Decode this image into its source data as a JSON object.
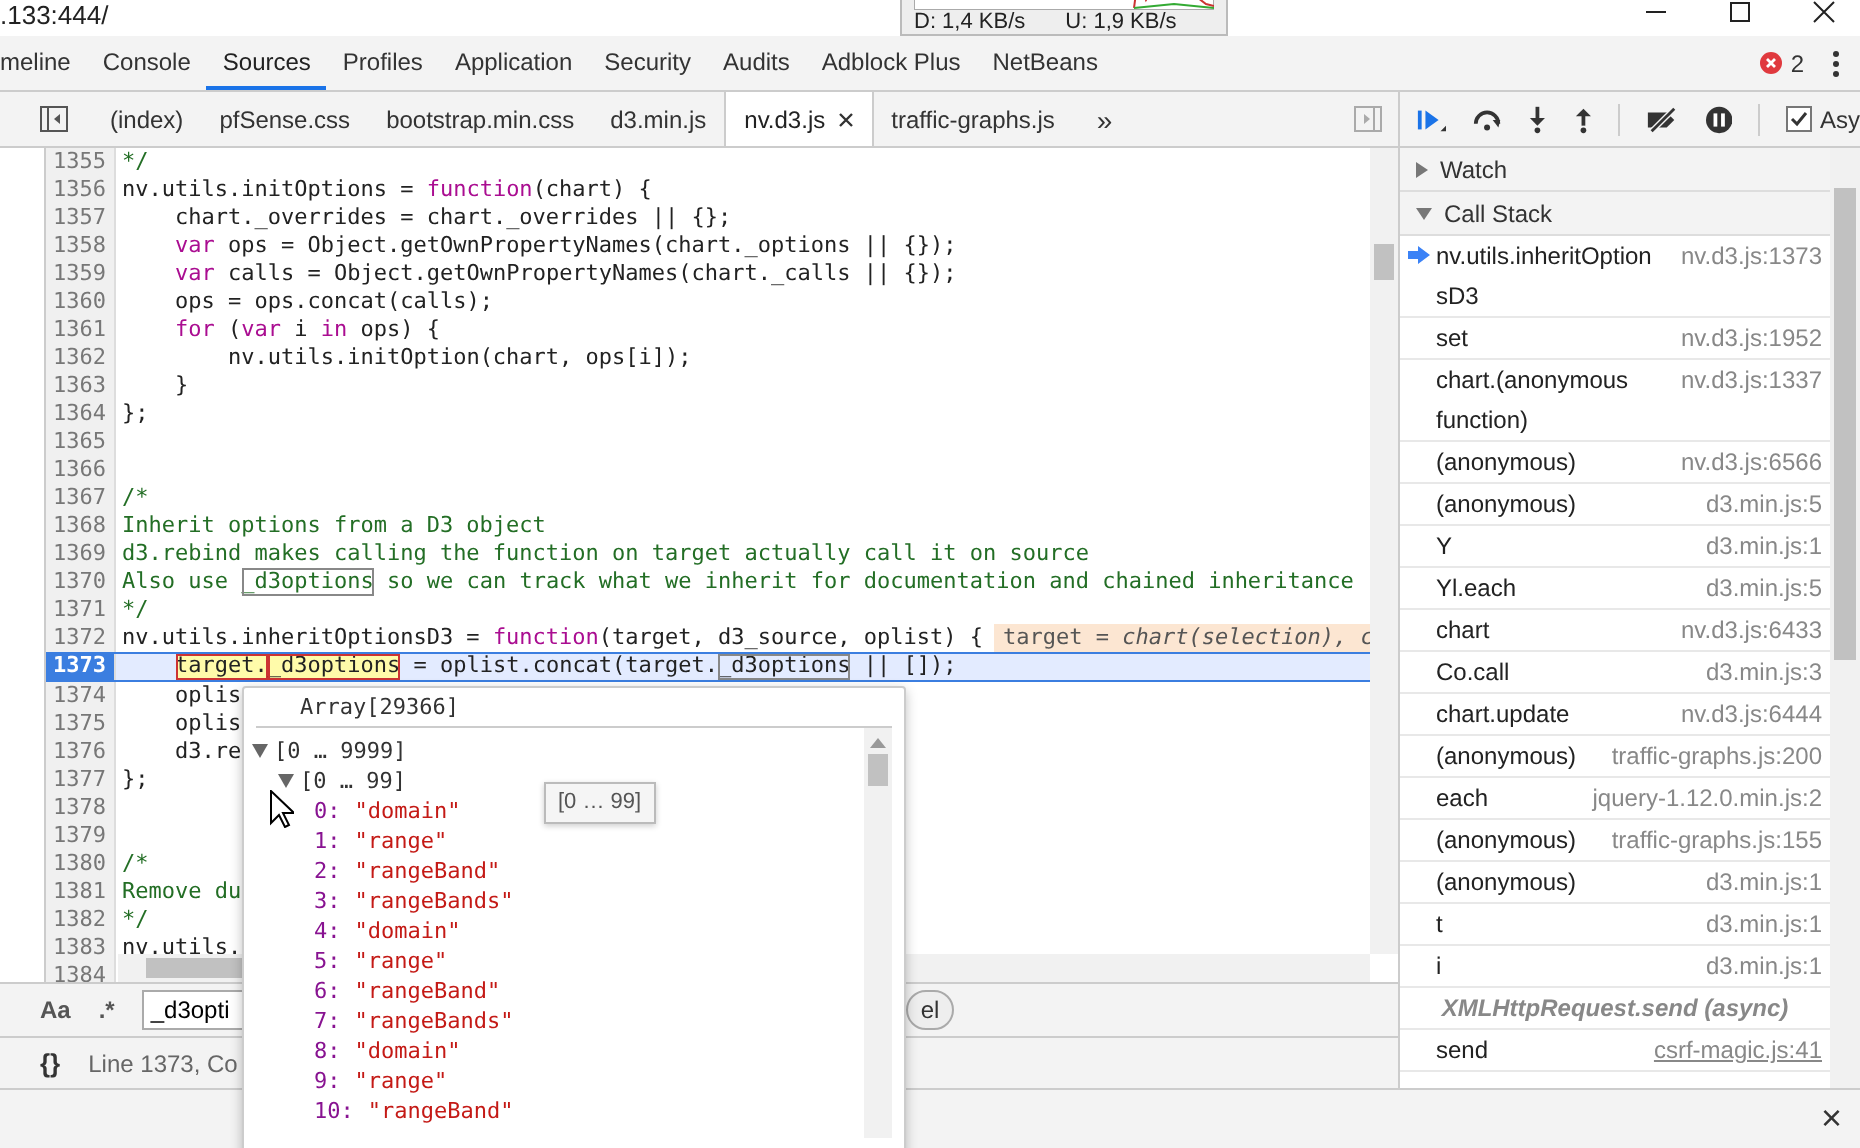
{
  "address": ".133:444/",
  "network_widget": {
    "download": "D: 1,4 KB/s",
    "upload": "U: 1,9 KB/s"
  },
  "panel_tabs": [
    {
      "label": "meline",
      "selected": false
    },
    {
      "label": "Console",
      "selected": false
    },
    {
      "label": "Sources",
      "selected": true
    },
    {
      "label": "Profiles",
      "selected": false
    },
    {
      "label": "Application",
      "selected": false
    },
    {
      "label": "Security",
      "selected": false
    },
    {
      "label": "Audits",
      "selected": false
    },
    {
      "label": "Adblock Plus",
      "selected": false
    },
    {
      "label": "NetBeans",
      "selected": false
    }
  ],
  "error_count": "2",
  "file_tabs": [
    {
      "label": "(index)",
      "selected": false
    },
    {
      "label": "pfSense.css",
      "selected": false
    },
    {
      "label": "bootstrap.min.css",
      "selected": false
    },
    {
      "label": "d3.min.js",
      "selected": false
    },
    {
      "label": "nv.d3.js",
      "selected": true
    },
    {
      "label": "traffic-graphs.js",
      "selected": false
    }
  ],
  "more_tabs": "»",
  "async_checkbox": {
    "label": "Asy",
    "checked": true
  },
  "code": [
    {
      "number": "1355",
      "current": false,
      "tokens": [
        {
          "kind": "comment",
          "text": "*/"
        }
      ]
    },
    {
      "number": "1356",
      "current": false,
      "tokens": [
        {
          "kind": "plain",
          "text": "nv.utils.initOptions = "
        },
        {
          "kind": "keyword",
          "text": "function"
        },
        {
          "kind": "plain",
          "text": "(chart) {"
        }
      ]
    },
    {
      "number": "1357",
      "current": false,
      "tokens": [
        {
          "kind": "plain",
          "text": "    chart._overrides = chart._overrides || {};"
        }
      ]
    },
    {
      "number": "1358",
      "current": false,
      "tokens": [
        {
          "kind": "keyword",
          "text": "    var"
        },
        {
          "kind": "plain",
          "text": " ops = Object.getOwnPropertyNames(chart._options || {});"
        }
      ]
    },
    {
      "number": "1359",
      "current": false,
      "tokens": [
        {
          "kind": "keyword",
          "text": "    var"
        },
        {
          "kind": "plain",
          "text": " calls = Object.getOwnPropertyNames(chart._calls || {});"
        }
      ]
    },
    {
      "number": "1360",
      "current": false,
      "tokens": [
        {
          "kind": "plain",
          "text": "    ops = ops.concat(calls);"
        }
      ]
    },
    {
      "number": "1361",
      "current": false,
      "tokens": [
        {
          "kind": "keyword",
          "text": "    for"
        },
        {
          "kind": "plain",
          "text": " ("
        },
        {
          "kind": "keyword",
          "text": "var"
        },
        {
          "kind": "plain",
          "text": " i "
        },
        {
          "kind": "keyword",
          "text": "in"
        },
        {
          "kind": "plain",
          "text": " ops) {"
        }
      ]
    },
    {
      "number": "1362",
      "current": false,
      "tokens": [
        {
          "kind": "plain",
          "text": "        nv.utils.initOption(chart, ops[i]);"
        }
      ]
    },
    {
      "number": "1363",
      "current": false,
      "tokens": [
        {
          "kind": "plain",
          "text": "    }"
        }
      ]
    },
    {
      "number": "1364",
      "current": false,
      "tokens": [
        {
          "kind": "plain",
          "text": "};"
        }
      ]
    },
    {
      "number": "1365",
      "current": false
    },
    {
      "number": "1366",
      "current": false
    },
    {
      "number": "1367",
      "current": false,
      "tokens": [
        {
          "kind": "comment",
          "text": "/*"
        }
      ]
    },
    {
      "number": "1368",
      "current": false,
      "tokens": [
        {
          "kind": "comment",
          "text": "Inherit options from a D3 object"
        }
      ]
    },
    {
      "number": "1369",
      "current": false,
      "tokens": [
        {
          "kind": "comment",
          "text": "d3.rebind makes calling the function on target actually call it on source"
        }
      ]
    },
    {
      "number": "1370",
      "current": false,
      "tokens": [
        {
          "kind": "comment",
          "text": "Also use "
        },
        {
          "kind": "comment-match",
          "text": "_d3options"
        },
        {
          "kind": "comment",
          "text": " so we can track what we inherit for documentation and chained inheritance"
        }
      ]
    },
    {
      "number": "1371",
      "current": false,
      "tokens": [
        {
          "kind": "comment",
          "text": "*/"
        }
      ]
    },
    {
      "number": "1372",
      "current": false,
      "tokens": [
        {
          "kind": "plain",
          "text": "nv.utils.inheritOptionsD3 = "
        },
        {
          "kind": "keyword",
          "text": "function"
        },
        {
          "kind": "plain",
          "text": "(target, d3_source, oplist) {"
        }
      ],
      "inline_value": "target = *chart(selection), c*"
    },
    {
      "number": "1373",
      "current": true,
      "tokens": [
        {
          "kind": "hover",
          "text": "    target."
        },
        {
          "kind": "hover-match",
          "text": "_d3options"
        },
        {
          "kind": "plain",
          "text": " = oplist.concat(target."
        },
        {
          "kind": "match",
          "text": "_d3options"
        },
        {
          "kind": "plain",
          "text": " || []);"
        }
      ]
    },
    {
      "number": "1374",
      "current": false,
      "tokens": [
        {
          "kind": "plain",
          "text": "    oplis"
        }
      ]
    },
    {
      "number": "1375",
      "current": false,
      "tokens": [
        {
          "kind": "plain",
          "text": "    oplis"
        }
      ]
    },
    {
      "number": "1376",
      "current": false,
      "tokens": [
        {
          "kind": "plain",
          "text": "    d3.re"
        }
      ]
    },
    {
      "number": "1377",
      "current": false,
      "tokens": [
        {
          "kind": "plain",
          "text": "};"
        }
      ]
    },
    {
      "number": "1378",
      "current": false
    },
    {
      "number": "1379",
      "current": false
    },
    {
      "number": "1380",
      "current": false,
      "tokens": [
        {
          "kind": "comment",
          "text": "/*"
        }
      ]
    },
    {
      "number": "1381",
      "current": false,
      "tokens": [
        {
          "kind": "comment",
          "text": "Remove du"
        }
      ]
    },
    {
      "number": "1382",
      "current": false,
      "tokens": [
        {
          "kind": "comment",
          "text": "*/"
        }
      ]
    },
    {
      "number": "1383",
      "current": false,
      "tokens": [
        {
          "kind": "plain",
          "text": "nv.utils."
        }
      ]
    },
    {
      "number": "1384",
      "current": false
    }
  ],
  "popup": {
    "title": "Array[29366]",
    "tree": [
      {
        "label": "[0 … 9999]",
        "expanded": true,
        "children": [
          {
            "label": "[0 … 99]",
            "expanded": true,
            "tooltip": "[0 … 99]",
            "children": [
              {
                "index": "0:",
                "value": "\"domain\""
              },
              {
                "index": "1:",
                "value": "\"range\""
              },
              {
                "index": "2:",
                "value": "\"rangeBand\""
              },
              {
                "index": "3:",
                "value": "\"rangeBands\""
              },
              {
                "index": "4:",
                "value": "\"domain\""
              },
              {
                "index": "5:",
                "value": "\"range\""
              },
              {
                "index": "6:",
                "value": "\"rangeBand\""
              },
              {
                "index": "7:",
                "value": "\"rangeBands\""
              },
              {
                "index": "8:",
                "value": "\"domain\""
              },
              {
                "index": "9:",
                "value": "\"range\""
              },
              {
                "index": "10:",
                "value": "\"rangeBand\""
              }
            ]
          }
        ]
      }
    ]
  },
  "search": {
    "case_label": "Aa",
    "regex_label": ".*",
    "value": "_d3opti",
    "cancel_label": "el"
  },
  "status": {
    "format_label": "{}",
    "position": "Line 1373, Co"
  },
  "sidebar": {
    "sections": [
      {
        "label": "Watch",
        "expanded": false
      },
      {
        "label": "Call Stack",
        "expanded": true
      }
    ],
    "call_stack": [
      {
        "kind": "frame",
        "name": "nv.utils.inheritOptionsD3",
        "location": "nv.d3.js:1373",
        "selected": true,
        "link": false
      },
      {
        "kind": "frame",
        "name": "set",
        "location": "nv.d3.js:1952",
        "selected": false,
        "link": false
      },
      {
        "kind": "frame",
        "name": "chart.(anonymous function)",
        "location": "nv.d3.js:1337",
        "selected": false,
        "link": false
      },
      {
        "kind": "frame",
        "name": "(anonymous)",
        "location": "nv.d3.js:6566",
        "selected": false,
        "link": false
      },
      {
        "kind": "frame",
        "name": "(anonymous)",
        "location": "d3.min.js:5",
        "selected": false,
        "link": false
      },
      {
        "kind": "frame",
        "name": "Y",
        "location": "d3.min.js:1",
        "selected": false,
        "link": false
      },
      {
        "kind": "frame",
        "name": "Yl.each",
        "location": "d3.min.js:5",
        "selected": false,
        "link": false
      },
      {
        "kind": "frame",
        "name": "chart",
        "location": "nv.d3.js:6433",
        "selected": false,
        "link": false
      },
      {
        "kind": "frame",
        "name": "Co.call",
        "location": "d3.min.js:3",
        "selected": false,
        "link": false
      },
      {
        "kind": "frame",
        "name": "chart.update",
        "location": "nv.d3.js:6444",
        "selected": false,
        "link": false
      },
      {
        "kind": "frame",
        "name": "(anonymous)",
        "location": "traffic-graphs.js:200",
        "selected": false,
        "link": false
      },
      {
        "kind": "frame",
        "name": "each",
        "location": "jquery-1.12.0.min.js:2",
        "selected": false,
        "link": false
      },
      {
        "kind": "frame",
        "name": "(anonymous)",
        "location": "traffic-graphs.js:155",
        "selected": false,
        "link": false
      },
      {
        "kind": "frame",
        "name": "(anonymous)",
        "location": "d3.min.js:1",
        "selected": false,
        "link": false
      },
      {
        "kind": "frame",
        "name": "t",
        "location": "d3.min.js:1",
        "selected": false,
        "link": false
      },
      {
        "kind": "frame",
        "name": "i",
        "location": "d3.min.js:1",
        "selected": false,
        "link": false
      },
      {
        "kind": "async",
        "name": "XMLHttpRequest.send (async)"
      },
      {
        "kind": "frame",
        "name": "send",
        "location": "csrf-magic.js:41",
        "selected": false,
        "link": true
      }
    ]
  },
  "drawer": {
    "close_label": "×"
  }
}
